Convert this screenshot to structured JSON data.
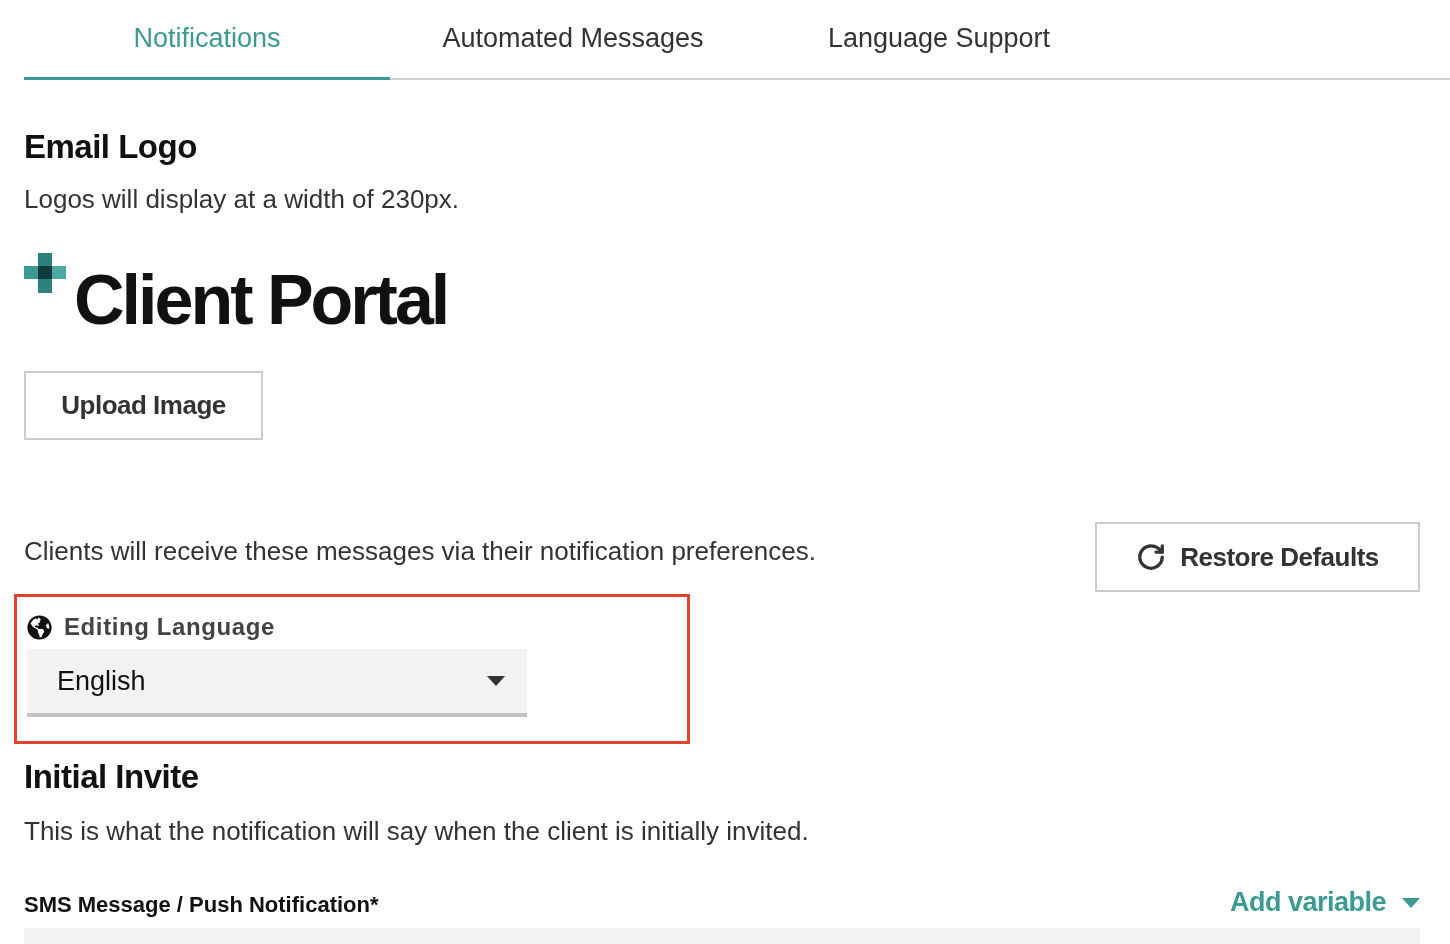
{
  "tabs": [
    {
      "label": "Notifications",
      "selected": true
    },
    {
      "label": "Automated Messages",
      "selected": false
    },
    {
      "label": "Language Support",
      "selected": false
    }
  ],
  "email_logo": {
    "title": "Email Logo",
    "description": "Logos will display at a width of 230px.",
    "logo_text": "Client Portal",
    "upload_button": "Upload Image"
  },
  "messages": {
    "description": "Clients will receive these messages via their notification preferences.",
    "restore_button": "Restore Defaults"
  },
  "editing_language": {
    "label": "Editing Language",
    "value": "English",
    "highlighted": true
  },
  "initial_invite": {
    "title": "Initial Invite",
    "description": "This is what the notification will say when the client is initially invited.",
    "field_label": "SMS Message / Push Notification*",
    "add_variable": "Add variable"
  }
}
